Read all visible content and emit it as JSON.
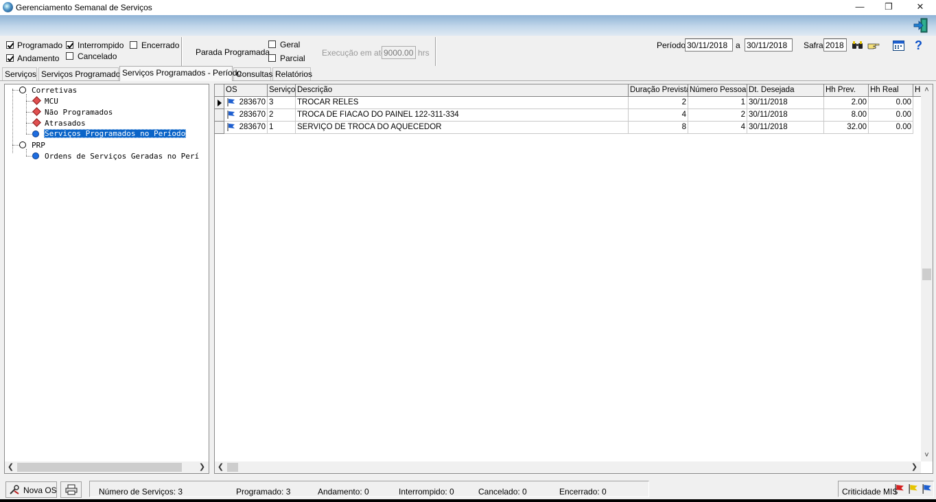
{
  "window": {
    "title": "Gerenciamento Semanal de Serviços",
    "minimize": "—",
    "restore": "❐",
    "close": "✕"
  },
  "filters": {
    "programado": {
      "label": "Programado",
      "checked": true
    },
    "andamento": {
      "label": "Andamento",
      "checked": true
    },
    "interrompido": {
      "label": "Interrompido",
      "checked": true
    },
    "cancelado": {
      "label": "Cancelado",
      "checked": false
    },
    "encerrado": {
      "label": "Encerrado",
      "checked": false
    },
    "parada_programada_label": "Parada Programada",
    "geral": {
      "label": "Geral",
      "checked": false
    },
    "parcial": {
      "label": "Parcial",
      "checked": false
    },
    "execucao_label": "Execução em até",
    "execucao_value": "9000.00",
    "execucao_unit": "hrs"
  },
  "period": {
    "label": "Período",
    "from": "30/11/2018",
    "sep": "a",
    "to": "30/11/2018",
    "safra_label": "Safra",
    "safra_value": "2018"
  },
  "tabs": [
    {
      "label": "Serviços",
      "active": false
    },
    {
      "label": "Serviços Programados",
      "active": false
    },
    {
      "label": "Serviços Programados - Período",
      "active": true
    },
    {
      "label": "Consultas",
      "active": false
    },
    {
      "label": "Relatórios",
      "active": false
    }
  ],
  "tree": {
    "corretivas": "Corretivas",
    "mcu": "MCU",
    "nao_programados": "Não Programados",
    "atrasados": "Atrasados",
    "servicos_periodo": "Serviços Programados no Período",
    "prp": "PRP",
    "ordens": "Ordens de Serviços Geradas no Perí"
  },
  "grid": {
    "columns": [
      "OS",
      "Serviço",
      "Descrição",
      "Duração Prevista",
      "Número Pessoas",
      "Dt. Desejada",
      "Hh Prev.",
      "Hh Real",
      "H"
    ],
    "rows": [
      {
        "os": "283670",
        "servico": "3",
        "descricao": "TROCAR RELES",
        "duracao": "2",
        "pessoas": "1",
        "dt": "30/11/2018",
        "hh_prev": "2.00",
        "hh_real": "0.00",
        "current": true
      },
      {
        "os": "283670",
        "servico": "2",
        "descricao": "TROCA DE FIACAO DO PAINEL 122-311-334",
        "duracao": "4",
        "pessoas": "2",
        "dt": "30/11/2018",
        "hh_prev": "8.00",
        "hh_real": "0.00",
        "current": false
      },
      {
        "os": "283670",
        "servico": "1",
        "descricao": "SERVIÇO DE TROCA DO AQUECEDOR",
        "duracao": "8",
        "pessoas": "4",
        "dt": "30/11/2018",
        "hh_prev": "32.00",
        "hh_real": "0.00",
        "current": false
      }
    ]
  },
  "status": {
    "nova_os": "Nova OS",
    "num_servicos": "Número de Serviços: 3",
    "programado": "Programado: 3",
    "andamento": "Andamento: 0",
    "interrompido": "Interrompido: 0",
    "cancelado": "Cancelado: 0",
    "encerrado": "Encerrado: 0",
    "criticidade": "Criticidade MIS"
  },
  "colors": {
    "selection": "#0a64c8",
    "flag_blue": "#1e5fd0",
    "flag_red": "#d42020",
    "flag_yellow": "#e6c400"
  },
  "icons": [
    "exit-icon",
    "binoculars-icon",
    "pointing-hand-icon",
    "calendar-icon",
    "help-icon",
    "printer-icon",
    "new-os-icon",
    "flag-icon"
  ]
}
